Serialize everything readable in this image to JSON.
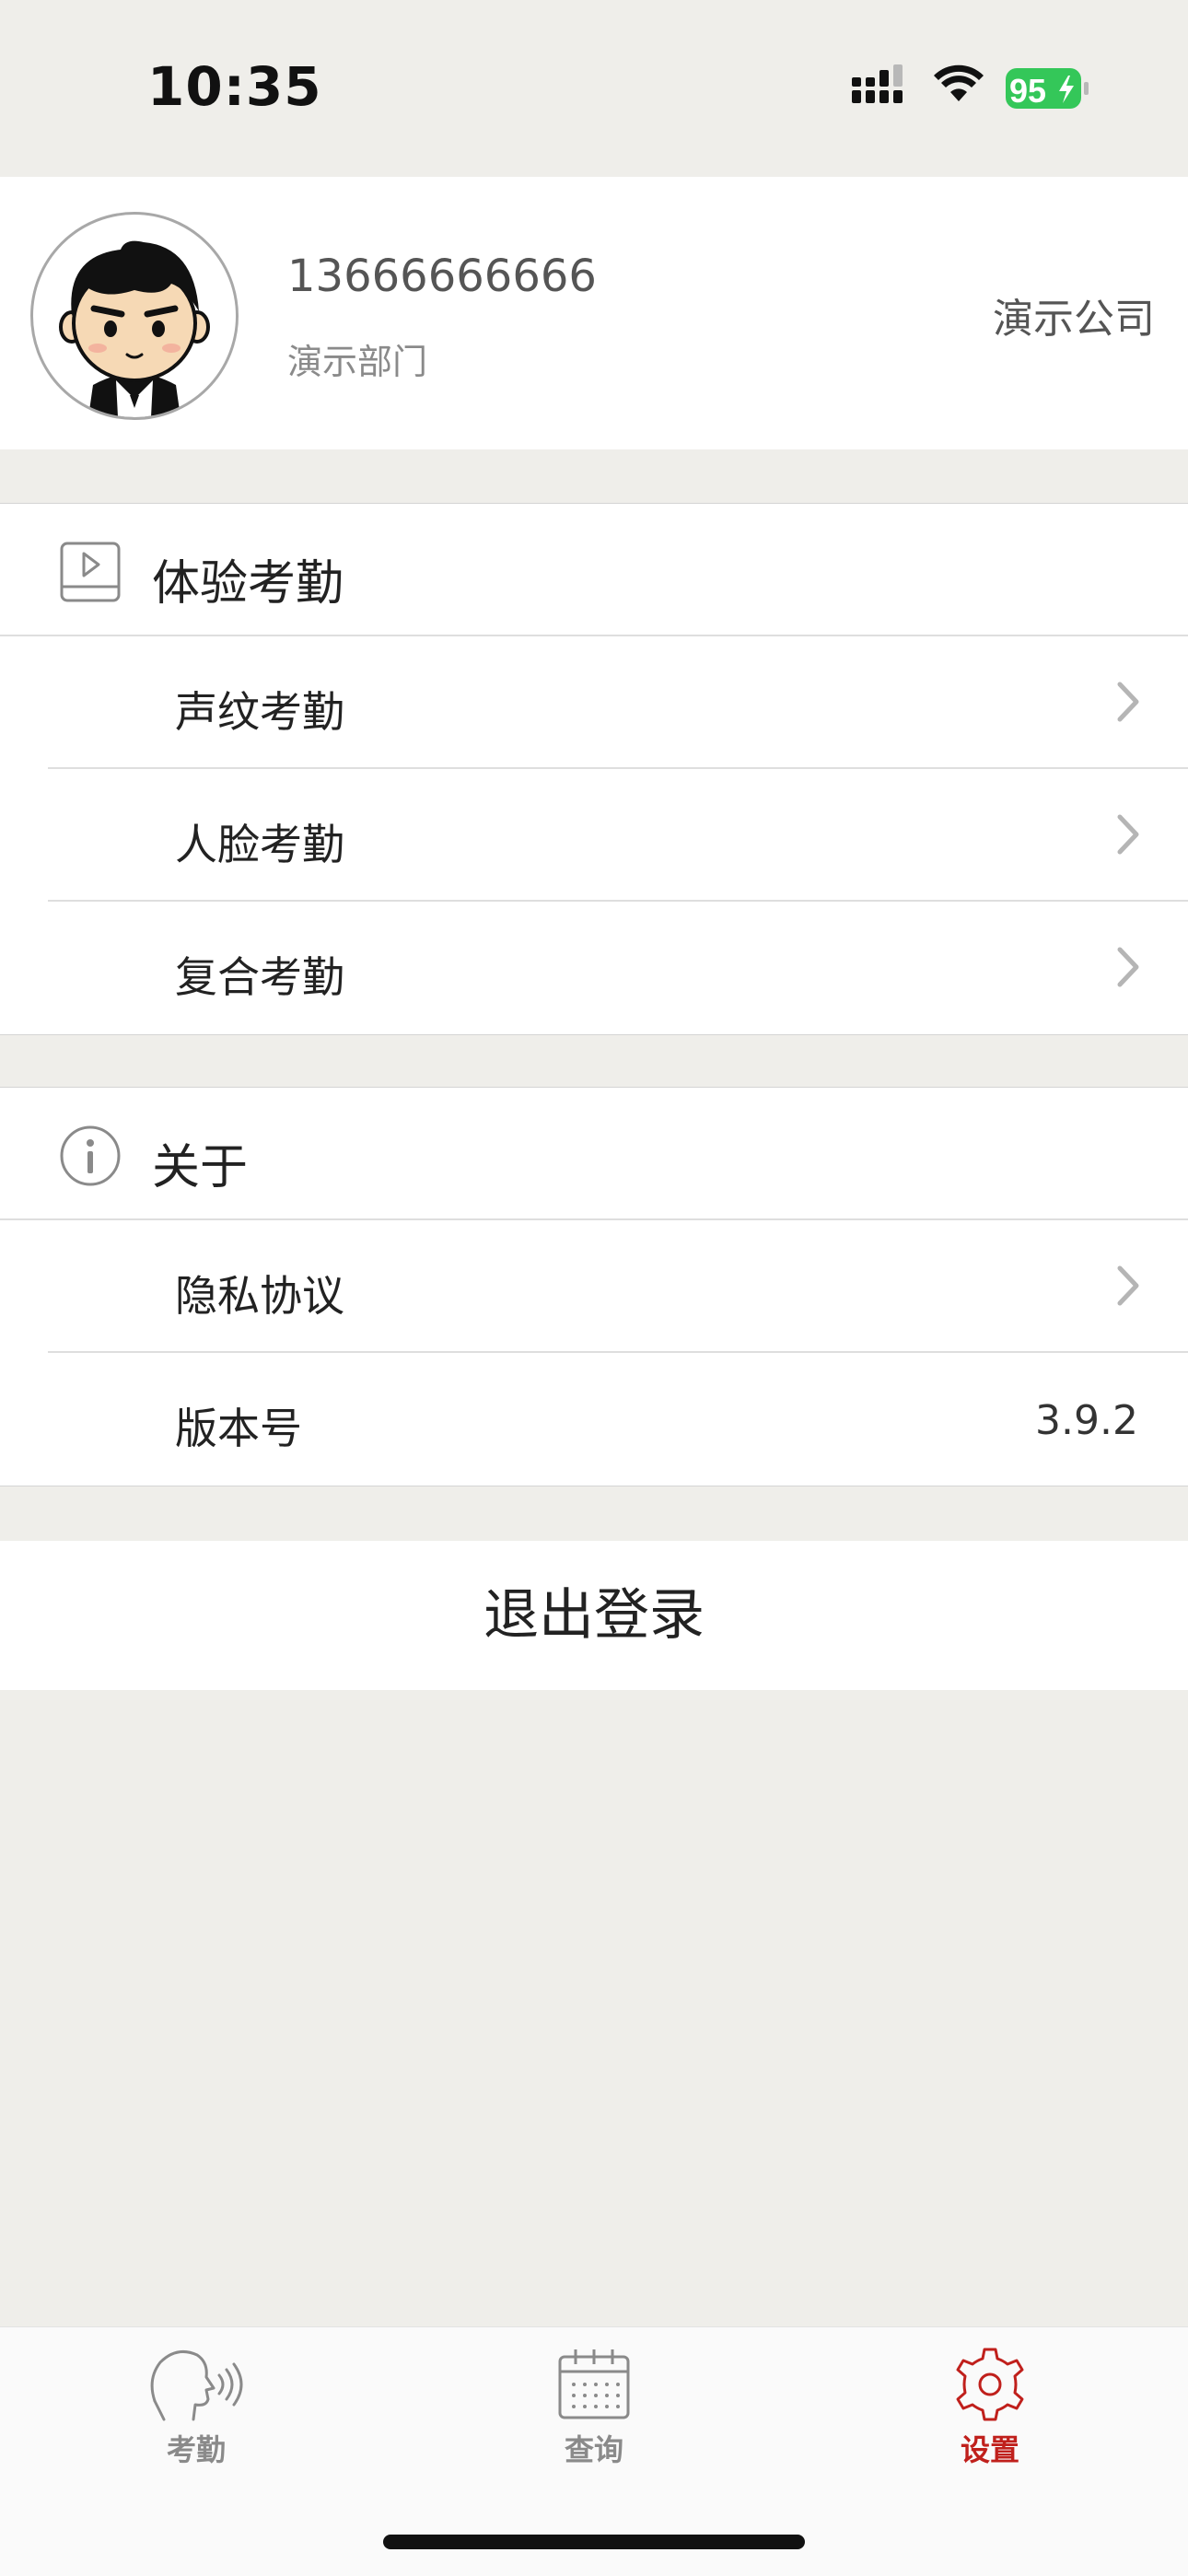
{
  "status_bar": {
    "time": "10:35",
    "battery": "95"
  },
  "profile": {
    "phone": "13666666666",
    "department": "演示部门",
    "company": "演示公司"
  },
  "sections": {
    "experience": {
      "title": "体验考勤",
      "icon": "play-card-icon",
      "items": [
        {
          "label": "声纹考勤"
        },
        {
          "label": "人脸考勤"
        },
        {
          "label": "复合考勤"
        }
      ]
    },
    "about": {
      "title": "关于",
      "icon": "info-circle-icon",
      "items": [
        {
          "label": "隐私协议"
        },
        {
          "label": "版本号",
          "value": "3.9.2"
        }
      ]
    }
  },
  "logout_label": "退出登录",
  "tabbar": {
    "tabs": [
      {
        "label": "考勤",
        "icon": "voice-head-icon",
        "active": false
      },
      {
        "label": "查询",
        "icon": "calendar-icon",
        "active": false
      },
      {
        "label": "设置",
        "icon": "gear-icon",
        "active": true
      }
    ]
  },
  "colors": {
    "background": "#efeeea",
    "accent": "#c0201c",
    "battery": "#34c759"
  }
}
